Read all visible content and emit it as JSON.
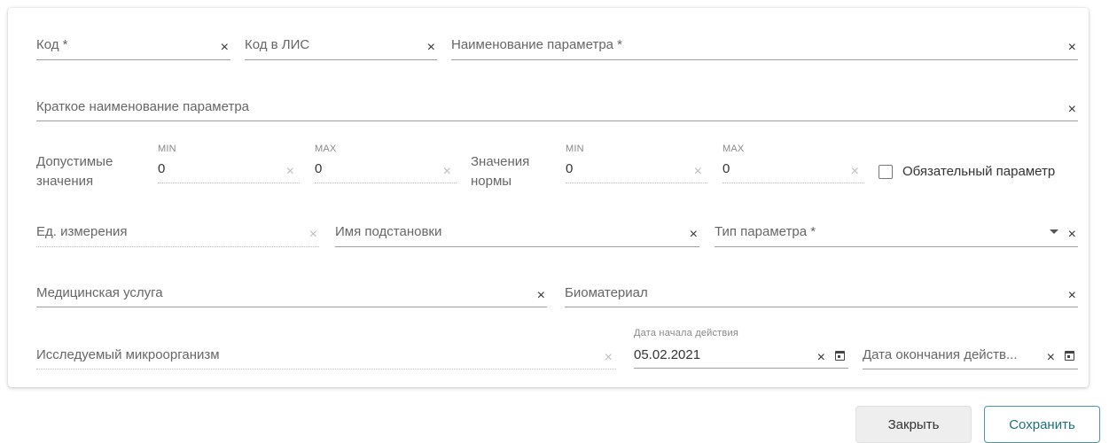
{
  "form": {
    "code": {
      "label": "Код *"
    },
    "lis_code": {
      "label": "Код в ЛИС"
    },
    "param_name": {
      "label": "Наименование параметра *"
    },
    "short_name": {
      "label": "Краткое наименование параметра"
    },
    "allowed_values": {
      "label_line1": "Допустимые",
      "label_line2": "значения",
      "min_label": "MIN",
      "min_value": "0",
      "max_label": "MAX",
      "max_value": "0"
    },
    "norm_values": {
      "label_line1": "Значения",
      "label_line2": "нормы",
      "min_label": "MIN",
      "min_value": "0",
      "max_label": "MAX",
      "max_value": "0"
    },
    "required_checkbox": {
      "label": "Обязательный параметр",
      "checked": false
    },
    "unit": {
      "label": "Ед. измерения"
    },
    "substitution_name": {
      "label": "Имя подстановки"
    },
    "param_type": {
      "label": "Тип параметра *"
    },
    "medical_service": {
      "label": "Медицинская услуга"
    },
    "biomaterial": {
      "label": "Биоматериал"
    },
    "microorganism": {
      "label": "Исследуемый микроорганизм"
    },
    "start_date": {
      "label": "Дата начала действия",
      "value": "05.02.2021"
    },
    "end_date": {
      "label": "Дата окончания действ..."
    }
  },
  "buttons": {
    "close": "Закрыть",
    "save": "Сохранить"
  },
  "icons": {
    "clear": "×"
  },
  "colors": {
    "accent": "#4a9ba6",
    "save_text": "#1f6f7a"
  }
}
